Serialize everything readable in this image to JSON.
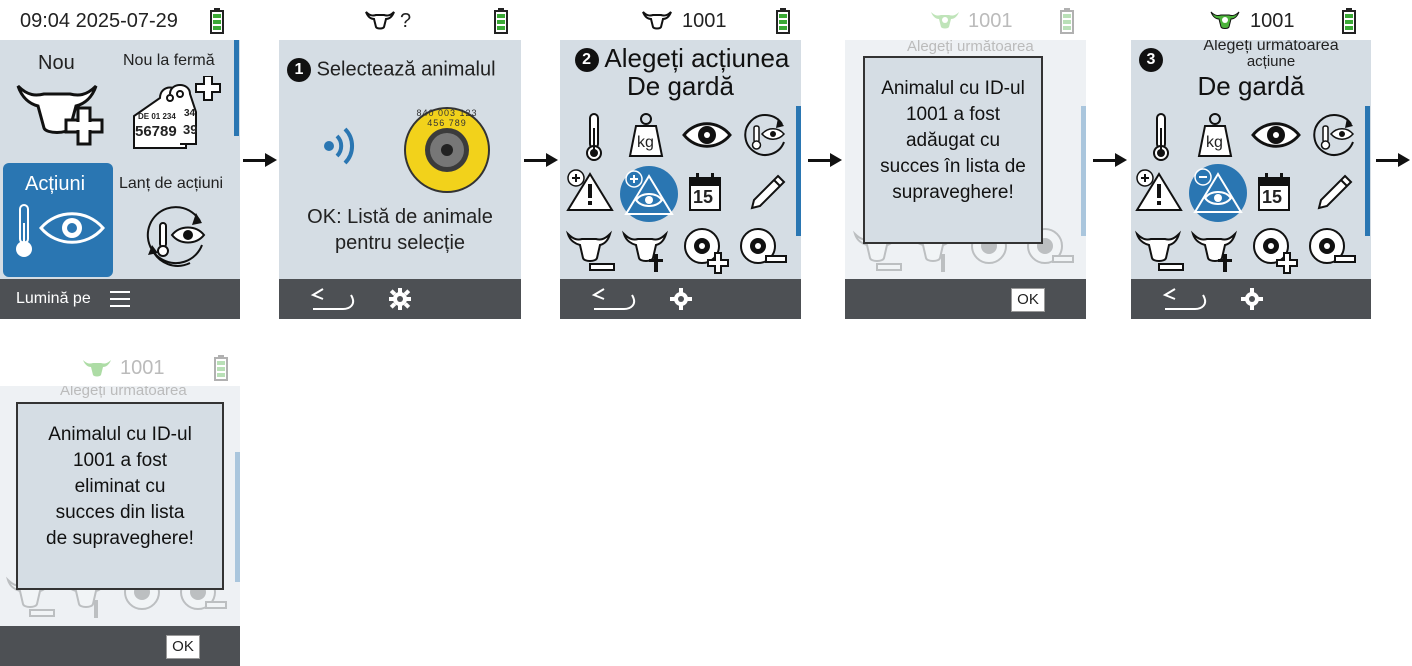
{
  "screen1": {
    "time": "09:04",
    "date": "2025-07-29",
    "tile_new": "Nou",
    "tile_new_farm": "Nou la fermă",
    "tag_line1": "DE 01 234",
    "tag_line2": "56789",
    "tag_side": "34",
    "tag_side2": "39",
    "tile_actions": "Acțiuni",
    "tile_chain": "Lanț de acțiuni",
    "footer_label": "Lumină pe"
  },
  "screen2": {
    "status": "?",
    "step": "1",
    "heading": "Selectează animalul",
    "tag_digits": "840 003 123 456 789",
    "hint_line1": "OK: Listă de animale",
    "hint_line2": "pentru selecție"
  },
  "screen3": {
    "animal_id": "1001",
    "step": "2",
    "heading_line1": "Alegeți acțiunea",
    "heading_line2": "De gardă",
    "kg_label": "kg",
    "calendar_day": "15"
  },
  "screen4": {
    "animal_id": "1001",
    "faded_heading": "Alegeți următoarea",
    "dialog_line1": "Animalul cu ID-ul",
    "dialog_line2": "1001 a fost",
    "dialog_line3": "adăugat cu",
    "dialog_line4": "succes în lista de",
    "dialog_line5": "supraveghere!",
    "ok_label": "OK"
  },
  "screen5": {
    "animal_id": "1001",
    "step": "3",
    "heading_line1": "Alegeți următoarea",
    "heading_line2": "acțiune",
    "heading_line3": "De gardă",
    "kg_label": "kg",
    "calendar_day": "15"
  },
  "screen6": {
    "animal_id": "1001",
    "faded_heading": "Alegeți următoarea",
    "dialog_line1": "Animalul cu ID-ul",
    "dialog_line2": "1001 a fost",
    "dialog_line3": "eliminat cu",
    "dialog_line4": "succes din lista",
    "dialog_line5": "de supraveghere!",
    "ok_label": "OK"
  },
  "colors": {
    "screen_bg": "#d5dde4",
    "accent_blue": "#2a76b2",
    "footer_bg": "#4d5054",
    "battery_green": "#3aa935",
    "tag_yellow": "#f2d21b",
    "cow_green": "#4bb33a"
  }
}
